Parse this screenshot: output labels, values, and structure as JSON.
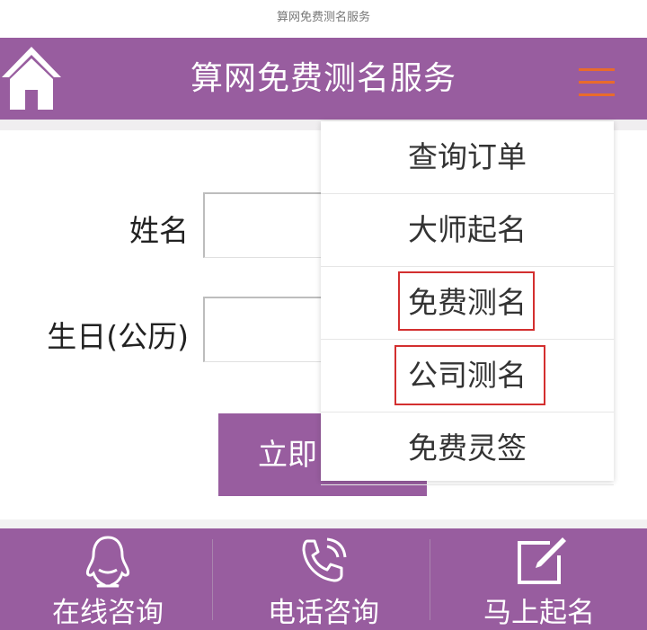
{
  "window": {
    "title": "算网免费测名服务"
  },
  "header": {
    "title": "算网免费测名服务",
    "home_icon": "home-icon",
    "menu_icon": "hamburger-menu-icon",
    "accent_color": "#985d9f",
    "menu_icon_color": "#e96b2c"
  },
  "form": {
    "name_label": "姓名",
    "name_value": "",
    "birthday_label": "生日(公历)",
    "birthday_value": "",
    "submit_label": "立即"
  },
  "dropdown": {
    "items": [
      {
        "label": "查询订单",
        "highlighted": false
      },
      {
        "label": "大师起名",
        "highlighted": false
      },
      {
        "label": "免费测名",
        "highlighted": true
      },
      {
        "label": "公司测名",
        "highlighted": true
      },
      {
        "label": "免费灵签",
        "highlighted": false
      }
    ],
    "highlight_color": "#d32f2f"
  },
  "footer": {
    "items": [
      {
        "label": "在线咨询",
        "icon": "qq-penguin-icon"
      },
      {
        "label": "电话咨询",
        "icon": "phone-icon"
      },
      {
        "label": "马上起名",
        "icon": "edit-icon"
      }
    ]
  }
}
